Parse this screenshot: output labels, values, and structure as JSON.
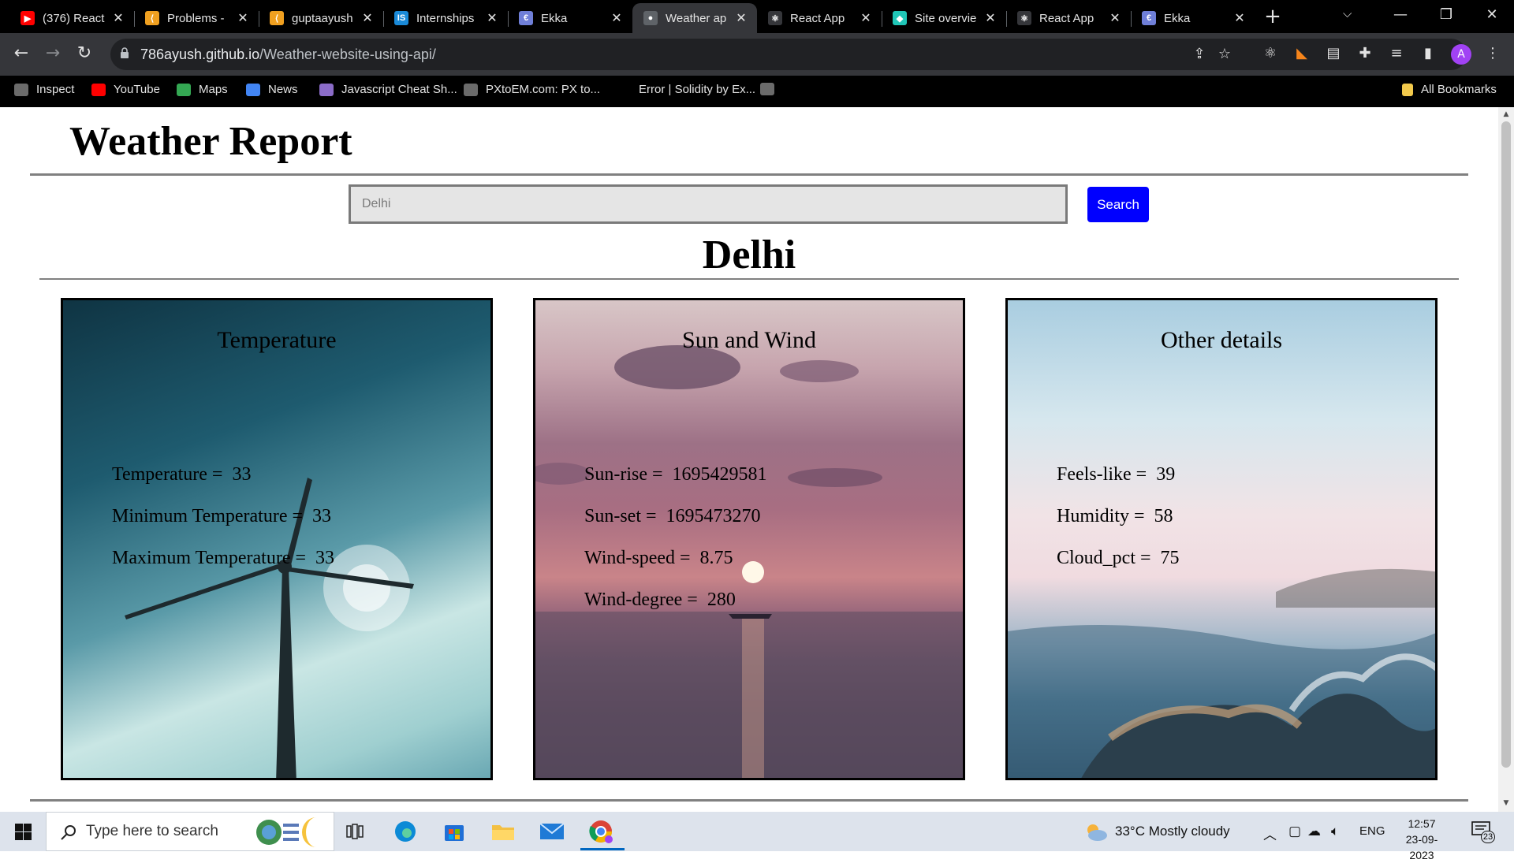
{
  "browser": {
    "tabs": [
      {
        "title": "(376) React",
        "favicon": "youtube-icon",
        "color": "#ff0000",
        "glyph": "▶"
      },
      {
        "title": "Problems -",
        "favicon": "leetcode-icon",
        "color": "#f0a020",
        "glyph": "⟨"
      },
      {
        "title": "guptaayush",
        "favicon": "leetcode-icon",
        "color": "#f0a020",
        "glyph": "⟨"
      },
      {
        "title": "Internships",
        "favicon": "internshala-icon",
        "color": "#1a8ad8",
        "glyph": "IS"
      },
      {
        "title": "Ekka",
        "favicon": "ekka-icon",
        "color": "#6f7fd8",
        "glyph": "€"
      },
      {
        "title": "Weather ap",
        "favicon": "github-icon",
        "color": "#5f6368",
        "glyph": "●",
        "active": true
      },
      {
        "title": "React App",
        "favicon": "react-icon",
        "color": "#35363a",
        "glyph": "⚛"
      },
      {
        "title": "Site overvie",
        "favicon": "netlify-icon",
        "color": "#20c6b7",
        "glyph": "◆"
      },
      {
        "title": "React App",
        "favicon": "react-icon",
        "color": "#35363a",
        "glyph": "⚛"
      },
      {
        "title": "Ekka",
        "favicon": "ekka-icon",
        "color": "#6f7fd8",
        "glyph": "€"
      }
    ],
    "url_host": "786ayush.github.io",
    "url_path": "/Weather-website-using-api/",
    "avatar_letter": "A",
    "bookmarks": [
      {
        "label": "Inspect",
        "icon": "globe-icon",
        "color": "#6b6b6b"
      },
      {
        "label": "YouTube",
        "icon": "youtube-icon",
        "color": "#ff0000"
      },
      {
        "label": "Maps",
        "icon": "maps-icon",
        "color": "#34a853"
      },
      {
        "label": "News",
        "icon": "news-icon",
        "color": "#4285f4"
      },
      {
        "label": "Javascript Cheat Sh...",
        "icon": "bookmark-stripes-icon",
        "color": "#8b6cc8"
      },
      {
        "label": "PXtoEM.com: PX to...",
        "icon": "globe-icon",
        "color": "#6b6b6b"
      },
      {
        "label": "Error | Solidity by Ex...",
        "icon": "solidity-icon",
        "color": "#000000"
      },
      {
        "label": "",
        "icon": "github-icon",
        "color": "#6b6b6b"
      }
    ],
    "all_bookmarks": "All Bookmarks"
  },
  "page": {
    "title": "Weather Report",
    "search_placeholder": "Delhi",
    "search_button": "Search",
    "city": "Delhi",
    "cards": {
      "temperature": {
        "heading": "Temperature",
        "rows": [
          {
            "label": "Temperature = ",
            "value": "33"
          },
          {
            "label": "Minimum Temperature = ",
            "value": "33"
          },
          {
            "label": "Maximum Temperature = ",
            "value": "33"
          }
        ]
      },
      "sun_wind": {
        "heading": "Sun and Wind",
        "rows": [
          {
            "label": "Sun-rise = ",
            "value": "1695429581"
          },
          {
            "label": "Sun-set = ",
            "value": "1695473270"
          },
          {
            "label": "Wind-speed = ",
            "value": "8.75"
          },
          {
            "label": "Wind-degree = ",
            "value": "280"
          }
        ]
      },
      "other": {
        "heading": "Other details",
        "rows": [
          {
            "label": "Feels-like = ",
            "value": "39"
          },
          {
            "label": "Humidity = ",
            "value": "58"
          },
          {
            "label": "Cloud_pct = ",
            "value": "75"
          }
        ]
      }
    }
  },
  "taskbar": {
    "search_placeholder": "Type here to search",
    "weather": "33°C  Mostly cloudy",
    "language": "ENG",
    "time": "12:57",
    "date": "23-09-2023",
    "notification_count": "23"
  }
}
